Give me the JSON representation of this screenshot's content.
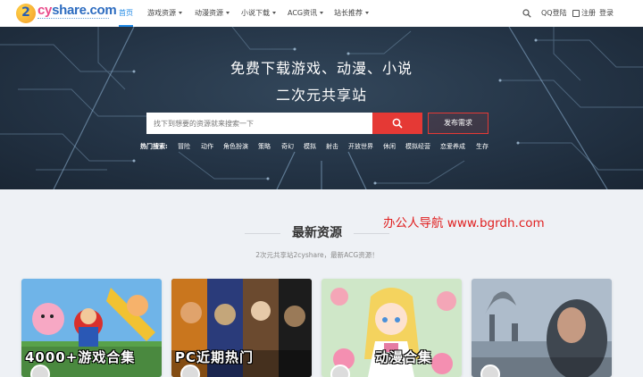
{
  "header": {
    "logo_letter": "2",
    "logo_text_pre": "c",
    "logo_text_y": "y",
    "logo_text_rest": "share.com",
    "nav": [
      {
        "label": "首页",
        "active": true,
        "dropdown": false
      },
      {
        "label": "游戏资源",
        "active": false,
        "dropdown": true
      },
      {
        "label": "动漫资源",
        "active": false,
        "dropdown": true
      },
      {
        "label": "小说下载",
        "active": false,
        "dropdown": true
      },
      {
        "label": "ACG资讯",
        "active": false,
        "dropdown": true
      },
      {
        "label": "站长推荐",
        "active": false,
        "dropdown": true
      }
    ],
    "qq_login": "QQ登陆",
    "register": "注册",
    "login": "登录"
  },
  "hero": {
    "title_line1": "免费下载游戏、动漫、小说",
    "title_line2": "二次元共享站",
    "search_placeholder": "找下到想要的资源就来搜索一下",
    "request_button": "发布需求",
    "hot_label": "热门搜索:",
    "hot_tags": [
      "冒险",
      "动作",
      "角色扮演",
      "策略",
      "奇幻",
      "模拟",
      "射击",
      "开放世界",
      "休闲",
      "模拟经营",
      "恋爱养成",
      "生存"
    ]
  },
  "section": {
    "title": "最新资源",
    "subtitle": "2次元共享站2cyshare，最新ACG资源！",
    "watermark": "办公人导航 www.bgrdh.com"
  },
  "cards": [
    {
      "caption": "4000+游戏合集"
    },
    {
      "caption": "PC近期热门"
    },
    {
      "caption": "动漫合集"
    },
    {
      "caption": ""
    }
  ],
  "colors": {
    "accent": "#1e88e5",
    "search_button": "#e53935",
    "hero_bg": "#243446",
    "watermark": "#e02020"
  }
}
